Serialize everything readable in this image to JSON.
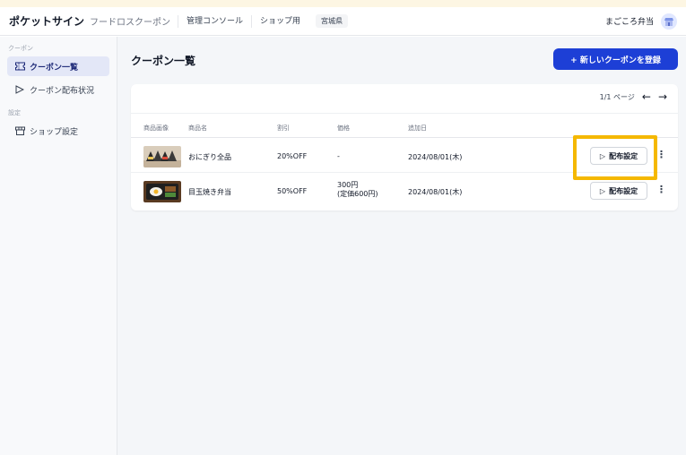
{
  "header": {
    "brand": "ポケットサイン",
    "subbrand": "フードロスクーポン",
    "nav": [
      "管理コンソール",
      "ショップ用"
    ],
    "prefecture": "宮城県",
    "shop_name": "まごころ弁当"
  },
  "sidebar": {
    "section_coupon": "クーポン",
    "items_coupon": [
      {
        "label": "クーポン一覧",
        "icon": "ticket-icon",
        "active": true
      },
      {
        "label": "クーポン配布状況",
        "icon": "send-icon",
        "active": false
      }
    ],
    "section_settings": "設定",
    "items_settings": [
      {
        "label": "ショップ設定",
        "icon": "store-icon",
        "active": false
      }
    ]
  },
  "main": {
    "title": "クーポン一覧",
    "new_button": "+ 新しいクーポンを登録",
    "pager": "1/1 ページ",
    "columns": [
      "商品画像",
      "商品名",
      "割引",
      "価格",
      "追加日"
    ],
    "rows": [
      {
        "name": "おにぎり全品",
        "discount": "20%OFF",
        "price": "-",
        "price_sub": "",
        "date": "2024/08/01(木)",
        "action": "配布設定"
      },
      {
        "name": "目玉焼き弁当",
        "discount": "50%OFF",
        "price": "300円",
        "price_sub": "(定価600円)",
        "date": "2024/08/01(木)",
        "action": "配布設定"
      }
    ]
  },
  "colors": {
    "accent": "#1d3fd6",
    "highlight": "#f5b800",
    "sidebar_active": "#e3e7f7"
  }
}
